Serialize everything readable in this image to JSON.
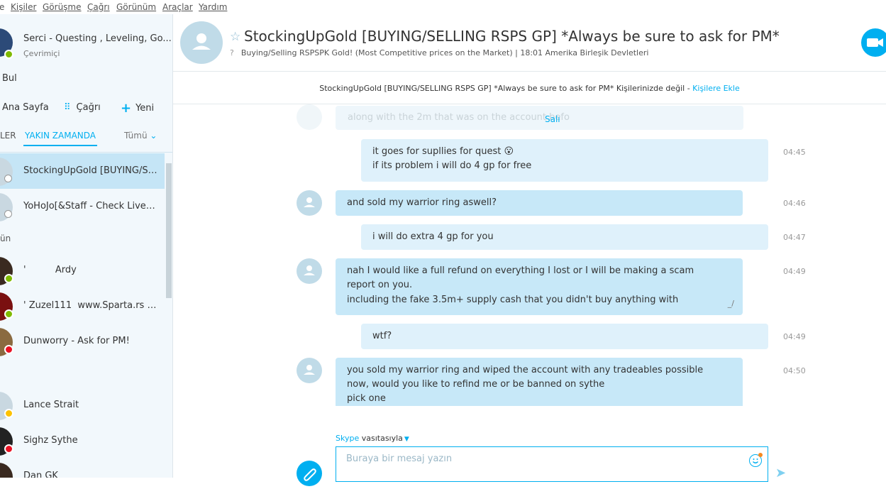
{
  "menu": [
    "e",
    "Kişiler",
    "Görüşme",
    "Çağrı",
    "Görünüm",
    "Araçlar",
    "Yardım"
  ],
  "profile": {
    "name": "Serci - Questing , Leveling, Go...",
    "status": "Çevrimiçi"
  },
  "find_label": "Bul",
  "actions": {
    "home": "Ana Sayfa",
    "call": "Çağrı",
    "new": "Yeni"
  },
  "tabs": {
    "people": "LER",
    "recent": "YAKIN ZAMANDA",
    "all": "Tümü"
  },
  "group_label": "ün",
  "contacts": [
    {
      "name": "StockingUpGold [BUYING/SEL...",
      "status": "unknown"
    },
    {
      "name": "YoHoJo[&Staff - Check Livech...",
      "status": "unknown"
    },
    {
      "name": "'          Ardy",
      "status": "online"
    },
    {
      "name": "' Zuzel111  www.Sparta.rs /...",
      "status": "online"
    },
    {
      "name": "Dunworry - Ask for PM!",
      "status": "busy"
    },
    {
      "name": "Lance Strait",
      "status": "away"
    },
    {
      "name": "Sighz Sythe",
      "status": "busy"
    },
    {
      "name": "Dan GK",
      "status": "online"
    }
  ],
  "header": {
    "title": "StockingUpGold [BUYING/SELLING RSPS GP] *Always be sure to ask for PM*",
    "subtitle": "Buying/Selling RSPSPK Gold! (Most Competitive prices on the Market)  |  18:01 Amerika Birleşik Devletleri"
  },
  "notice": {
    "text": "StockingUpGold [BUYING/SELLING RSPS GP] *Always be sure to ask for PM* Kişilerinizde değil - ",
    "link": "Kişilere Ekle"
  },
  "conversation": {
    "faded_text": "along with the 2m that was on the account befo",
    "day_label": "Salı",
    "messages": [
      {
        "dir": "out",
        "lines": [
          "it goes for supllies for quest 😮",
          "if its problem i will do 4 gp for free"
        ],
        "time": "04:45"
      },
      {
        "dir": "in",
        "lines": [
          "and sold my warrior ring aswell?"
        ],
        "time": "04:46"
      },
      {
        "dir": "out",
        "lines": [
          "i will do extra 4 gp for you"
        ],
        "time": "04:47"
      },
      {
        "dir": "in",
        "lines": [
          "nah I would like a full refund on everything I lost or I will be making a scam report on you.",
          "including the fake 3.5m+ supply cash that you didn't buy anything with"
        ],
        "time": "04:49"
      },
      {
        "dir": "out",
        "lines": [
          "wtf?"
        ],
        "time": "04:49"
      },
      {
        "dir": "in",
        "lines": [
          "you sold my warrior ring and wiped the account with any tradeables possible",
          "now, would you like to refind me or be banned on sythe",
          "pick one"
        ],
        "time": "04:50"
      }
    ]
  },
  "composer": {
    "via_brand": "Skype",
    "via_text": " vasıtasıyla",
    "placeholder": "Buraya bir mesaj yazın"
  },
  "colors": {
    "accent": "#00aff0",
    "incoming_bubble": "#c7e8f8",
    "outgoing_bubble": "#dff1fb",
    "online": "#7fba00",
    "busy": "#e81123",
    "away": "#fdc200"
  }
}
